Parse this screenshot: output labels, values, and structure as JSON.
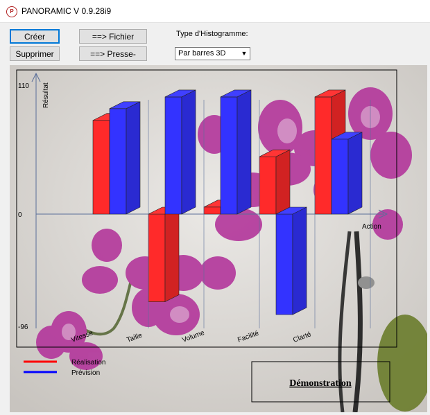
{
  "window": {
    "title": "PANORAMIC V 0.9.28i9",
    "icon": "panoramic-app-icon"
  },
  "buttons": {
    "creer": "Créer",
    "supprimer": "Supprimer",
    "fichier": "==> Fichier",
    "presse_papier": "==> Presse-Papier"
  },
  "histogram": {
    "label": "Type d'Histogramme:",
    "selected": "Par barres 3D"
  },
  "chart_data": {
    "type": "bar",
    "categories": [
      "Vitesse",
      "Taille",
      "Volume",
      "Facilité",
      "Clarté"
    ],
    "series": [
      {
        "name": "Réalisation",
        "color": "#ff2a2a",
        "values": [
          80,
          -75,
          6,
          49,
          100
        ]
      },
      {
        "name": "Prévision",
        "color": "#3333ff",
        "values": [
          90,
          100,
          100,
          -86,
          64
        ]
      }
    ],
    "ylabel": "Résultat",
    "xlabel": "Action",
    "ylim": [
      -96,
      110
    ],
    "ytick_labels": [
      "110",
      "0",
      "-96"
    ]
  },
  "legend": {
    "realisation": "Réalisation",
    "prevision": "Prévision",
    "realisation_color": "#ff0000",
    "prevision_color": "#0000ff"
  },
  "demo_label": "Démonstration"
}
